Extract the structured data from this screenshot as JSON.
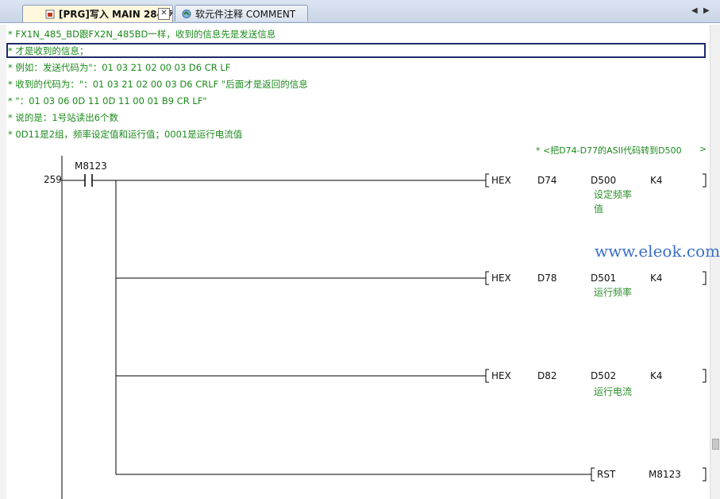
{
  "tabs": [
    {
      "label": "[PRG]写入 MAIN 284步",
      "icon": "program-icon",
      "active": true,
      "close": "✕"
    },
    {
      "label": "软元件注释 COMMENT",
      "icon": "comment-icon",
      "active": false
    }
  ],
  "tab_nav": {
    "left": "◀",
    "right": "▶"
  },
  "comments": [
    "* FX1N_485_BD跟FX2N_485BD一样，收到的信息先是发送信息",
    "* 才是收到的信息；",
    "* 例如：发送代码为\"：01 03 21 02 00 03 D6 CR LF",
    "* 收到的代码为：\"：01 03 21 02 00 03 D6 CRLF \"后面才是返回的信息",
    "* \"：01 03 06 0D 11 0D 11 00 01 B9 CR LF\"",
    "* 说的是：1号站读出6个数",
    "* 0D11是2组，频率设定值和运行值；0001是运行电流值"
  ],
  "note": {
    "text": "* <把D74-D77的ASII代码转到D500",
    "end": ">"
  },
  "step": "259",
  "contact": {
    "device": "M8123"
  },
  "rungs": [
    {
      "instr": "HEX",
      "src": "D74",
      "dst": "D500",
      "k": "K4",
      "dst_comment": [
        "设定频率",
        "值"
      ]
    },
    {
      "instr": "HEX",
      "src": "D78",
      "dst": "D501",
      "k": "K4",
      "dst_comment": [
        "运行频率"
      ]
    },
    {
      "instr": "HEX",
      "src": "D82",
      "dst": "D502",
      "k": "K4",
      "dst_comment": [
        "运行电流"
      ]
    }
  ],
  "rst": {
    "instr": "RST",
    "dev": "M8123"
  },
  "watermark": "www.eleok.com",
  "colors": {
    "comment": "#1b8a1b",
    "active_tab": "#fff8dc",
    "cursor_box": "#1d2b6b",
    "watermark": "#3b6fc6"
  }
}
